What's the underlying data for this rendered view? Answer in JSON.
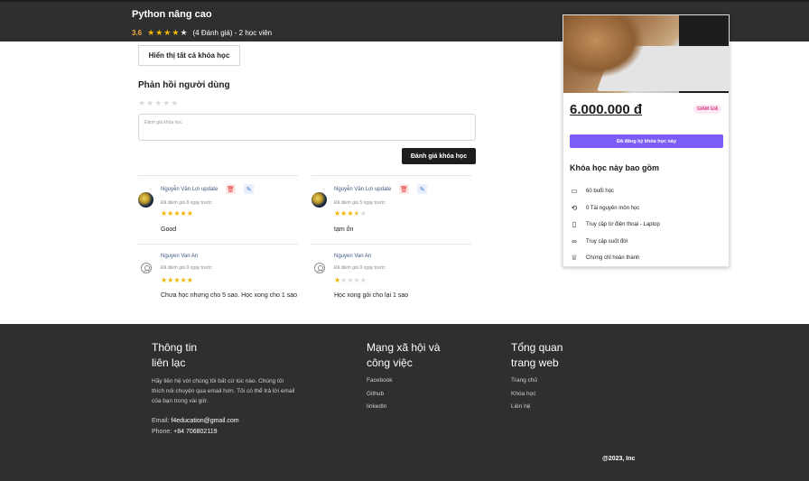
{
  "course": {
    "title": "Python nâng cao",
    "rating": "3.6",
    "stars": [
      "full",
      "full",
      "full",
      "full",
      "white"
    ],
    "rating_meta": "(4 Đánh giá) - 2 học viên"
  },
  "show_all_label": "Hiển thị tất cả khóa học",
  "feedback": {
    "title": "Phản hồi người dùng",
    "input_placeholder": "Đánh giá khóa học",
    "submit_label": "Đánh giá khóa học"
  },
  "reviews": [
    {
      "name": "Nguyễn Văn Lợi update",
      "time": "Đã đánh giá 8 ngày trước",
      "rating": 5,
      "text": "Good",
      "avatar": "image",
      "can_edit": true
    },
    {
      "name": "Nguyễn Văn Lợi update",
      "time": "Đã đánh giá 5 ngày trước",
      "rating": 3.5,
      "text": "tạm ổn",
      "avatar": "image",
      "can_edit": true
    },
    {
      "name": "Nguyen Van An",
      "time": "Đã đánh giá 9 ngày trước",
      "rating": 5,
      "text": "Chưa học nhưng cho 5 sao. Học xong cho 1 sao",
      "avatar": "user-icon",
      "can_edit": false
    },
    {
      "name": "Nguyen Van An",
      "time": "Đã đánh giá 9 ngày trước",
      "rating": 1,
      "text": "Học xong gòi cho lại 1 sao",
      "avatar": "user-icon",
      "can_edit": false
    }
  ],
  "card": {
    "price": "6.000.000 đ",
    "discount_badge": "GIẢM GIÁ",
    "enroll_label": "Đã đăng ký khóa học này",
    "includes_title": "Khóa học này bao gồm",
    "includes": [
      {
        "icon": "video-icon",
        "label": "60 buổi học"
      },
      {
        "icon": "resource-icon",
        "label": "0 Tài nguyên môn học"
      },
      {
        "icon": "phone-icon",
        "label": "Truy cập từ điện thoại - Laptop"
      },
      {
        "icon": "infinity-icon",
        "label": "Truy cập suốt đời"
      },
      {
        "icon": "trophy-icon",
        "label": "Chứng chỉ hoàn thành"
      }
    ]
  },
  "footer": {
    "contact_title": "Thông tin liên lạc",
    "contact_text": "Hãy liên hệ với chúng tôi bất cứ lúc nào. Chúng tôi thích nói chuyện qua email hơn. Tôi có thể trả lời email của bạn trong vài giờ.",
    "email_label": "Email:",
    "email": "f4education@gmail.com",
    "phone_label": "Phone:",
    "phone": "+84 706802119",
    "social_title": "Mạng xã hội và công việc",
    "social_links": [
      "Facebook",
      "Github",
      "linkedIn"
    ],
    "overview_title": "Tổng quan trang web",
    "overview_links": [
      "Trang chủ",
      "Khóa học",
      "Liên hệ"
    ],
    "copyright": "@2023, Inc",
    "colors": {
      "dark": "#2d2f31",
      "accent": "#7c5cf6",
      "star": "#f4b400"
    }
  }
}
